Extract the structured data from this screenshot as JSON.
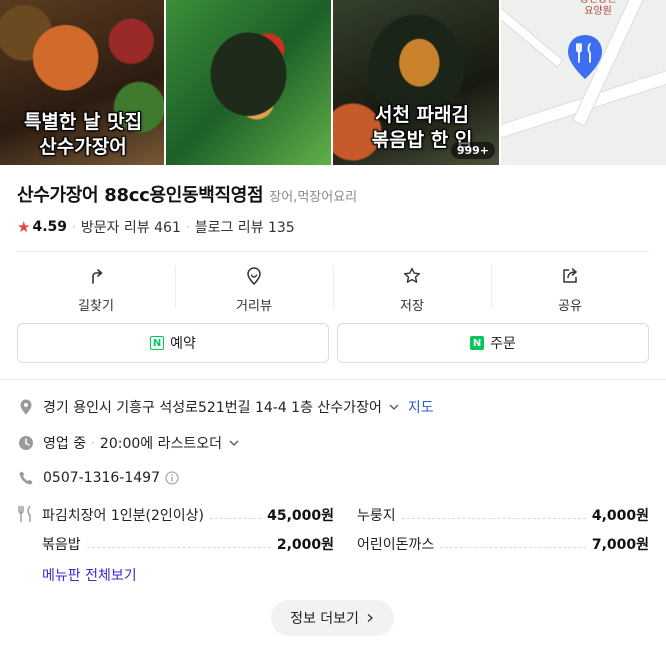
{
  "photos": {
    "captions": [
      "특별한 날 맛집\n산수가장어",
      "",
      "서천 파래김\n볶음밥 한 입",
      ""
    ],
    "photo_count": "999+",
    "map_label": "용인동인\n요양원"
  },
  "place": {
    "name": "산수가장어 88cc용인동백직영점",
    "category": "장어,먹장어요리",
    "rating": "4.59",
    "visitor_reviews": "방문자 리뷰 461",
    "blog_reviews": "블로그 리뷰 135"
  },
  "actions": [
    {
      "label": "길찾기",
      "icon": "directions-icon"
    },
    {
      "label": "거리뷰",
      "icon": "street-view-icon"
    },
    {
      "label": "저장",
      "icon": "star-outline-icon"
    },
    {
      "label": "공유",
      "icon": "share-icon"
    }
  ],
  "booking": {
    "reserve_label": "예약",
    "order_label": "주문"
  },
  "info": {
    "address": "경기 용인시 기흥구 석성로521번길 14-4 1층 산수가장어",
    "map_link": "지도",
    "hours": "영업 중",
    "last_order": "20:00에 라스트오더",
    "phone": "0507-1316-1497"
  },
  "menu": {
    "items": [
      {
        "name": "파김치장어 1인분(2인이상)",
        "price": "45,000원"
      },
      {
        "name": "누룽지",
        "price": "4,000원"
      },
      {
        "name": "볶음밥",
        "price": "2,000원"
      },
      {
        "name": "어린이돈까스",
        "price": "7,000원"
      }
    ],
    "view_all": "메뉴판 전체보기"
  },
  "more_info": "정보 더보기",
  "colors": {
    "rating_star": "#e8413a",
    "naver_green": "#03c75a",
    "link_blue": "#2d56d8",
    "menu_link": "#3a2bd1",
    "map_pin": "#3d6ef0"
  }
}
